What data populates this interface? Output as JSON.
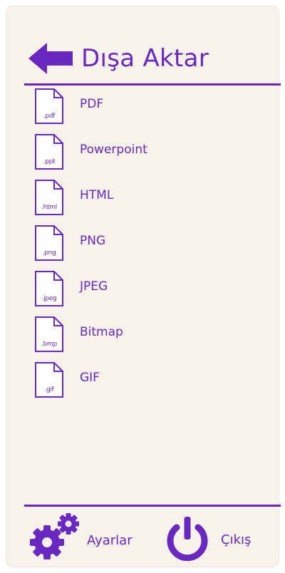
{
  "header": {
    "title": "Dışa Aktar",
    "back_icon": "left-arrow-icon"
  },
  "formats": [
    {
      "ext": ".pdf",
      "label": "PDF"
    },
    {
      "ext": ".ppt",
      "label": "Powerpoint"
    },
    {
      "ext": ".html",
      "label": "HTML"
    },
    {
      "ext": ".png",
      "label": "PNG"
    },
    {
      "ext": ".jpeg",
      "label": "JPEG"
    },
    {
      "ext": ".bmp",
      "label": "Bitmap"
    },
    {
      "ext": ".gif",
      "label": "GIF"
    }
  ],
  "footer": {
    "settings_label": "Ayarlar",
    "settings_icon": "gears-icon",
    "exit_label": "Çıkış",
    "exit_icon": "power-icon"
  },
  "colors": {
    "accent": "#6a28c2",
    "panel_background": "#f7f3ea"
  }
}
